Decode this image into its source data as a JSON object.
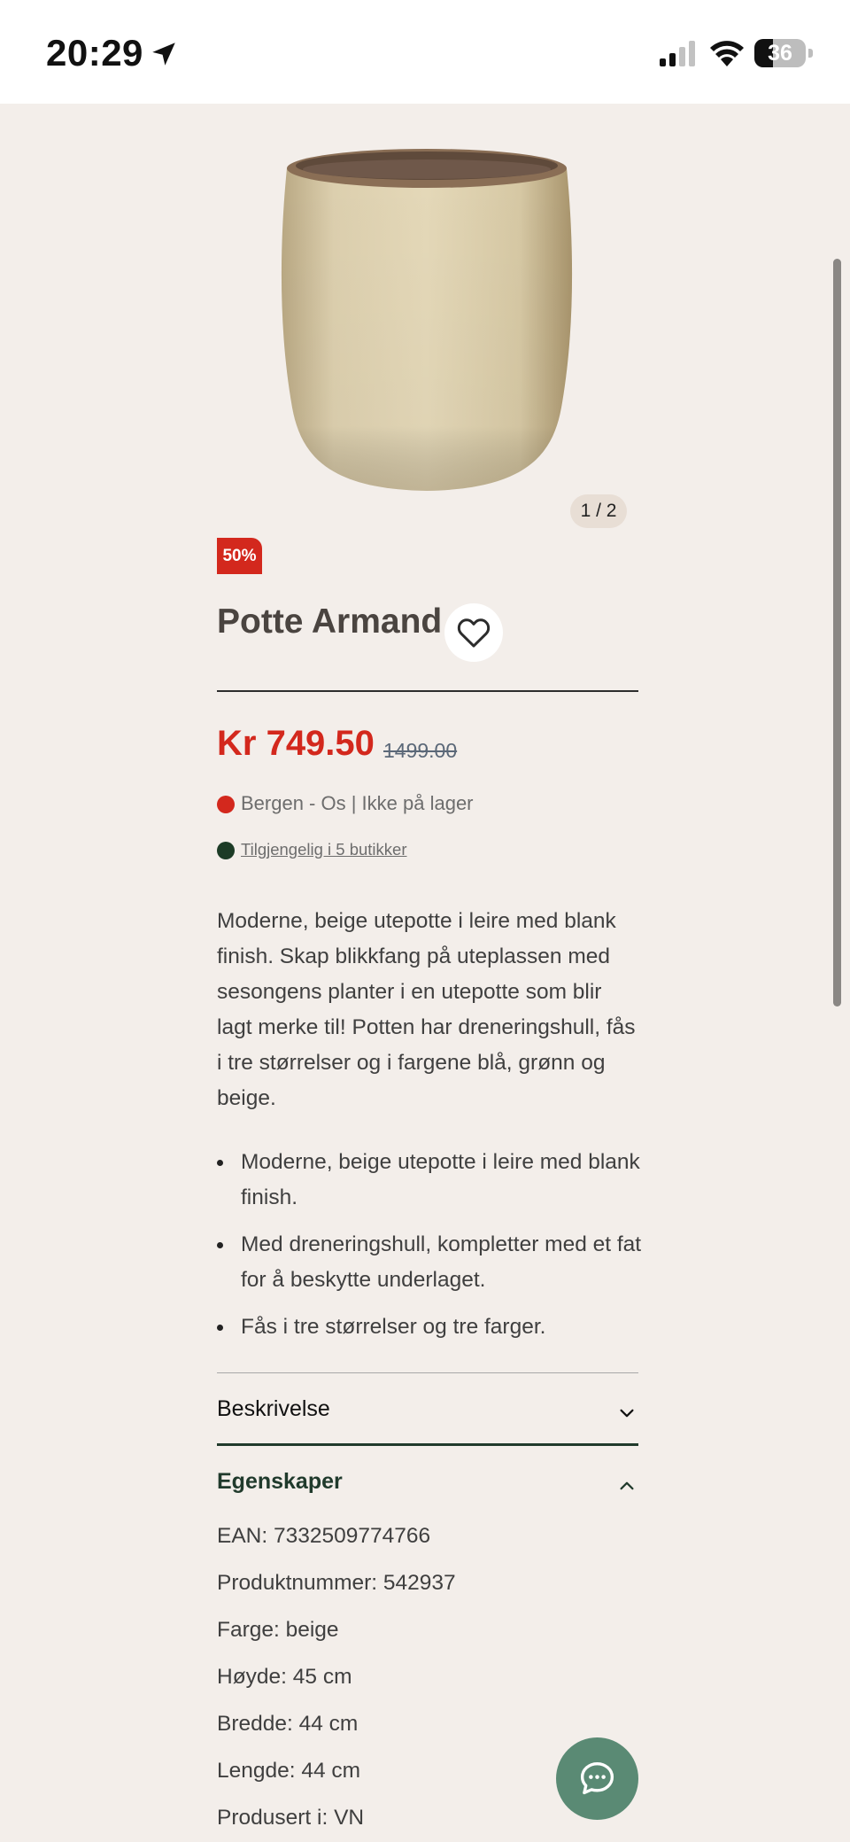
{
  "status_bar": {
    "time": "20:29",
    "battery_level": "36",
    "battery_fraction": 0.36,
    "icons": [
      "location-arrow-icon",
      "signal-icon",
      "wifi-icon",
      "battery-icon"
    ]
  },
  "product": {
    "image_counter": "1 / 2",
    "discount_badge": "50%",
    "title": "Potte Armand",
    "price": "Kr 749.50",
    "old_price": "1499.00",
    "stock_status": "Bergen - Os | Ikke på lager",
    "availability_link": "Tilgjengelig i 5 butikker",
    "description": "Moderne, beige utepotte i leire med blank finish. Skap blikkfang på uteplassen med sesongens planter i en utepotte som blir lagt merke til! Potten har dreneringshull, fås i tre størrelser og i fargene blå, grønn og beige.",
    "bullets": [
      "Moderne, beige utepotte i leire med blank finish.",
      "Med dreneringshull, kompletter med et fat for å beskytte underlaget.",
      "Fås i tre størrelser og tre farger."
    ]
  },
  "accordion": {
    "description_label": "Beskrivelse",
    "properties_label": "Egenskaper",
    "properties": {
      "ean": "EAN: 7332509774766",
      "product_number": "Produktnummer: 542937",
      "color": "Farge: beige",
      "height": "Høyde: 45 cm",
      "width": "Bredde: 44 cm",
      "length": "Lengde: 44 cm",
      "made_in": "Produsert i: VN"
    }
  },
  "colors": {
    "background": "#f3eeea",
    "sale_red": "#d3281d",
    "accent_green": "#203a2c",
    "chat_green": "#5a8a74",
    "stock_red_dot": "#d3281d",
    "stock_green_dot": "#1c3b26"
  }
}
